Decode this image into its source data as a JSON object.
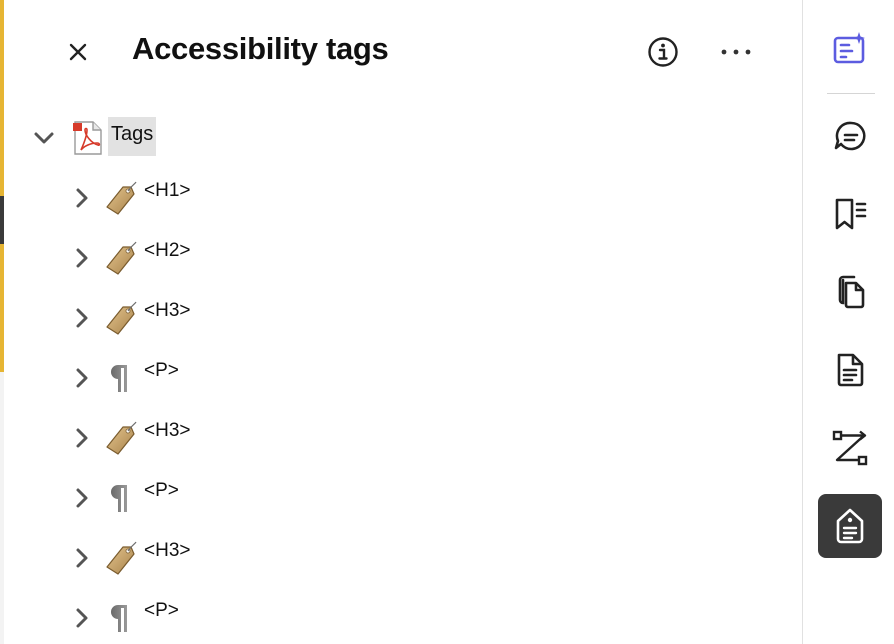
{
  "panel": {
    "title": "Accessibility tags",
    "close_icon": "close-icon",
    "info_icon": "info-icon",
    "more_icon": "more-icon"
  },
  "tree": {
    "root": {
      "label": "Tags",
      "icon": "pdf-file-icon",
      "expanded": true
    },
    "children": [
      {
        "label": "<H1>",
        "icon": "tag-icon"
      },
      {
        "label": "<H2>",
        "icon": "tag-icon"
      },
      {
        "label": "<H3>",
        "icon": "tag-icon"
      },
      {
        "label": "<P>",
        "icon": "paragraph-icon"
      },
      {
        "label": "<H3>",
        "icon": "tag-icon"
      },
      {
        "label": "<P>",
        "icon": "paragraph-icon"
      },
      {
        "label": "<H3>",
        "icon": "tag-icon"
      },
      {
        "label": "<P>",
        "icon": "paragraph-icon"
      }
    ]
  },
  "rail": {
    "items": [
      {
        "icon": "ai-assistant-icon",
        "active": false
      },
      {
        "icon": "comments-icon",
        "active": false
      },
      {
        "icon": "bookmarks-icon",
        "active": false
      },
      {
        "icon": "pages-icon",
        "active": false
      },
      {
        "icon": "document-icon",
        "active": false
      },
      {
        "icon": "reading-order-icon",
        "active": false
      },
      {
        "icon": "accessibility-tags-icon",
        "active": true
      }
    ],
    "colors": {
      "accent": "#5c5ce0",
      "active_bg": "#3a3a3a"
    }
  }
}
